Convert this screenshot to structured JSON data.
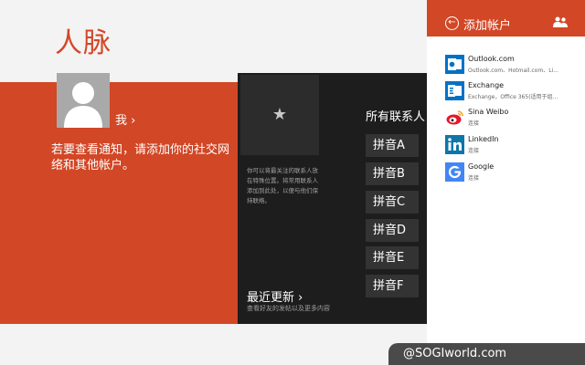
{
  "app": {
    "title": "人脉"
  },
  "me": {
    "link_label": "我 ›",
    "notice": "若要查看通知，请添加你的社交网络和其他帐户。"
  },
  "favorites": {
    "hint": "你可以将最关注的联系人放在特殊位置。将常用联系人添加到此处，以便与他们保持联络。"
  },
  "recent": {
    "title": "最近更新 ›",
    "subtitle": "查看好友的发帖以及更多内容"
  },
  "contacts": {
    "title": "所有联系人",
    "groups": [
      "拼音A",
      "拼音B",
      "拼音C",
      "拼音D",
      "拼音E",
      "拼音F"
    ]
  },
  "add_account_panel": {
    "title": "添加帐户",
    "accounts": [
      {
        "name": "Outlook.com",
        "desc": "Outlook.com、Hotmail.com、Li...",
        "icon": "outlook-icon",
        "color": "#0072c6"
      },
      {
        "name": "Exchange",
        "desc": "Exchange，Office 365(适用于组...",
        "icon": "exchange-icon",
        "color": "#0072c6"
      },
      {
        "name": "Sina Weibo",
        "desc": "连接",
        "icon": "weibo-icon",
        "color": "#e6162d"
      },
      {
        "name": "LinkedIn",
        "desc": "连接",
        "icon": "linkedin-icon",
        "color": "#0e76a8"
      },
      {
        "name": "Google",
        "desc": "连接",
        "icon": "google-icon",
        "color": "#4285f4"
      }
    ]
  },
  "watermark": {
    "text": "@SOGIworld.com"
  },
  "colors": {
    "accent": "#d24726",
    "dark": "#1d1d1d",
    "tile": "#333333"
  }
}
